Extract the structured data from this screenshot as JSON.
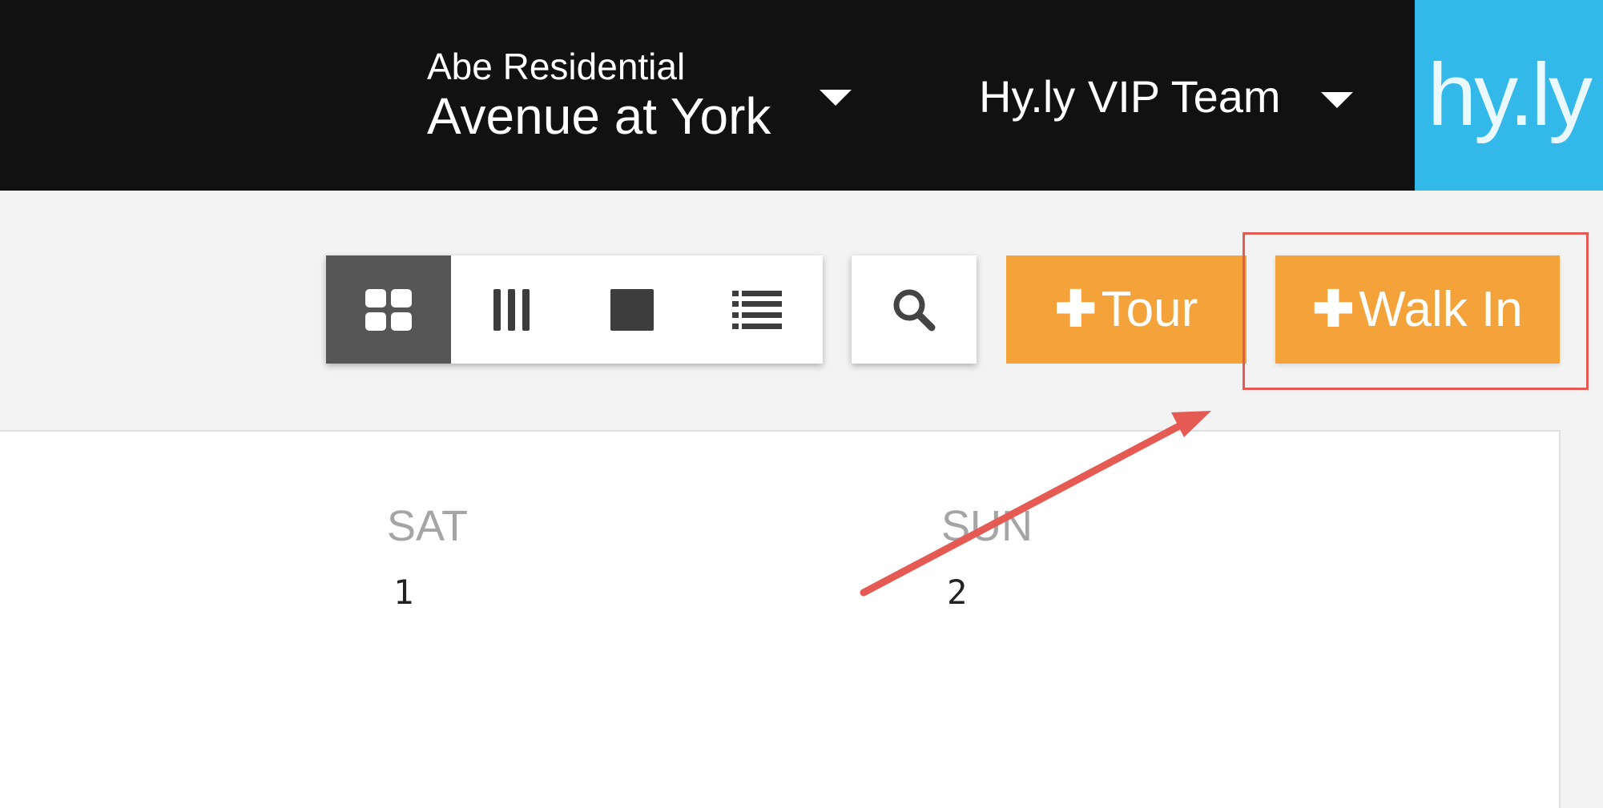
{
  "header": {
    "property_company": "Abe Residential",
    "property_name": "Avenue at York",
    "team_name": "Hy.ly VIP Team",
    "logo_text": "hy.ly"
  },
  "toolbar": {
    "view_buttons": [
      {
        "icon": "grid-view-icon",
        "active": true
      },
      {
        "icon": "columns-view-icon",
        "active": false
      },
      {
        "icon": "single-view-icon",
        "active": false
      },
      {
        "icon": "list-view-icon",
        "active": false
      }
    ],
    "search_icon": "search-icon",
    "tour_label": "Tour",
    "walkin_label": "Walk In",
    "plus_glyph": "✚"
  },
  "calendar": {
    "days": [
      {
        "name": "SAT",
        "number": "1"
      },
      {
        "name": "SUN",
        "number": "2"
      }
    ]
  },
  "colors": {
    "topbar": "#111111",
    "brand": "#33b8ea",
    "action": "#f3a33a",
    "annotation": "#e55a52",
    "active_view": "#555555"
  }
}
